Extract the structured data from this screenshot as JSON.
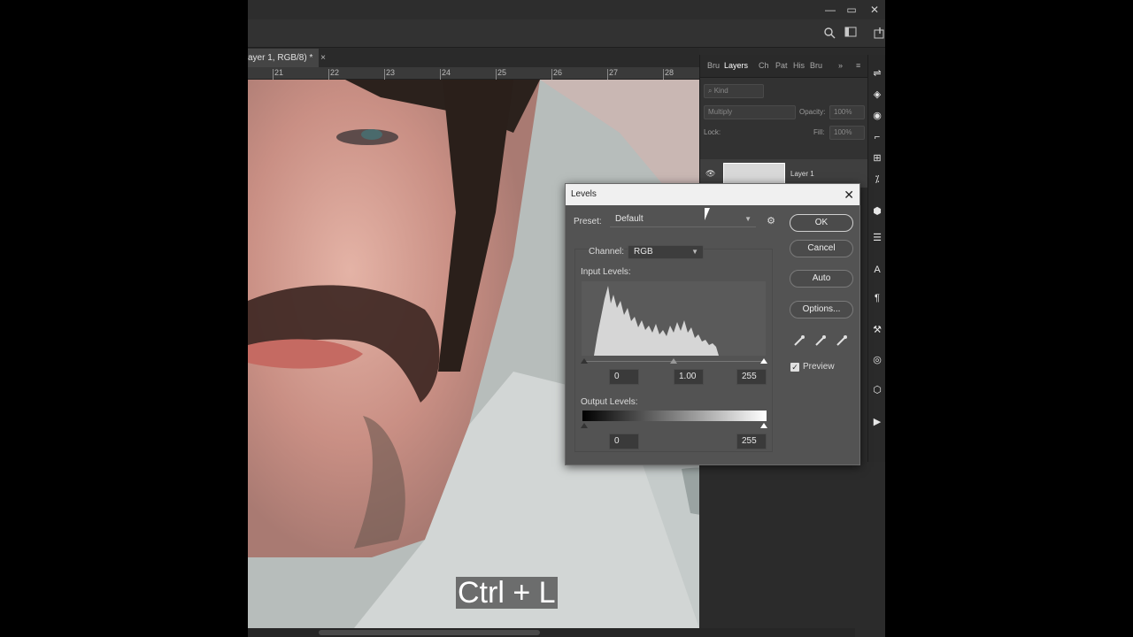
{
  "document": {
    "tab_title": "ayer 1, RGB/8) *",
    "tab_close": "×",
    "ruler_ticks": [
      "21",
      "22",
      "23",
      "24",
      "25",
      "26",
      "27",
      "28"
    ]
  },
  "window": {
    "minimize": "—",
    "restore": "▭",
    "close": "✕"
  },
  "layers_panel": {
    "tabs": [
      "Bru",
      "Layers",
      "Ch",
      "Pat",
      "His",
      "Bru"
    ],
    "active_tab": "Layers",
    "kind_placeholder": "Kind",
    "blend_mode": "Multiply",
    "opacity_label": "Opacity:",
    "opacity_value": "100%",
    "lock_label": "Lock:",
    "fill_label": "Fill:",
    "fill_value": "100%",
    "layer_name": "Layer 1"
  },
  "levels_dialog": {
    "title": "Levels",
    "preset_label": "Preset:",
    "preset_value": "Default",
    "channel_label": "Channel:",
    "channel_value": "RGB",
    "input_levels_label": "Input Levels:",
    "input_black": "0",
    "input_gamma": "1.00",
    "input_white": "255",
    "output_levels_label": "Output Levels:",
    "output_black": "0",
    "output_white": "255",
    "ok_label": "OK",
    "cancel_label": "Cancel",
    "auto_label": "Auto",
    "options_label": "Options...",
    "preview_label": "Preview",
    "preview_checked": true
  },
  "overlay": {
    "shortcut_caption": "Ctrl + L"
  },
  "colors": {
    "dialog_bg": "#535353",
    "titlebar_bg": "#f0f0f0",
    "app_bg": "#2b2b2b"
  }
}
